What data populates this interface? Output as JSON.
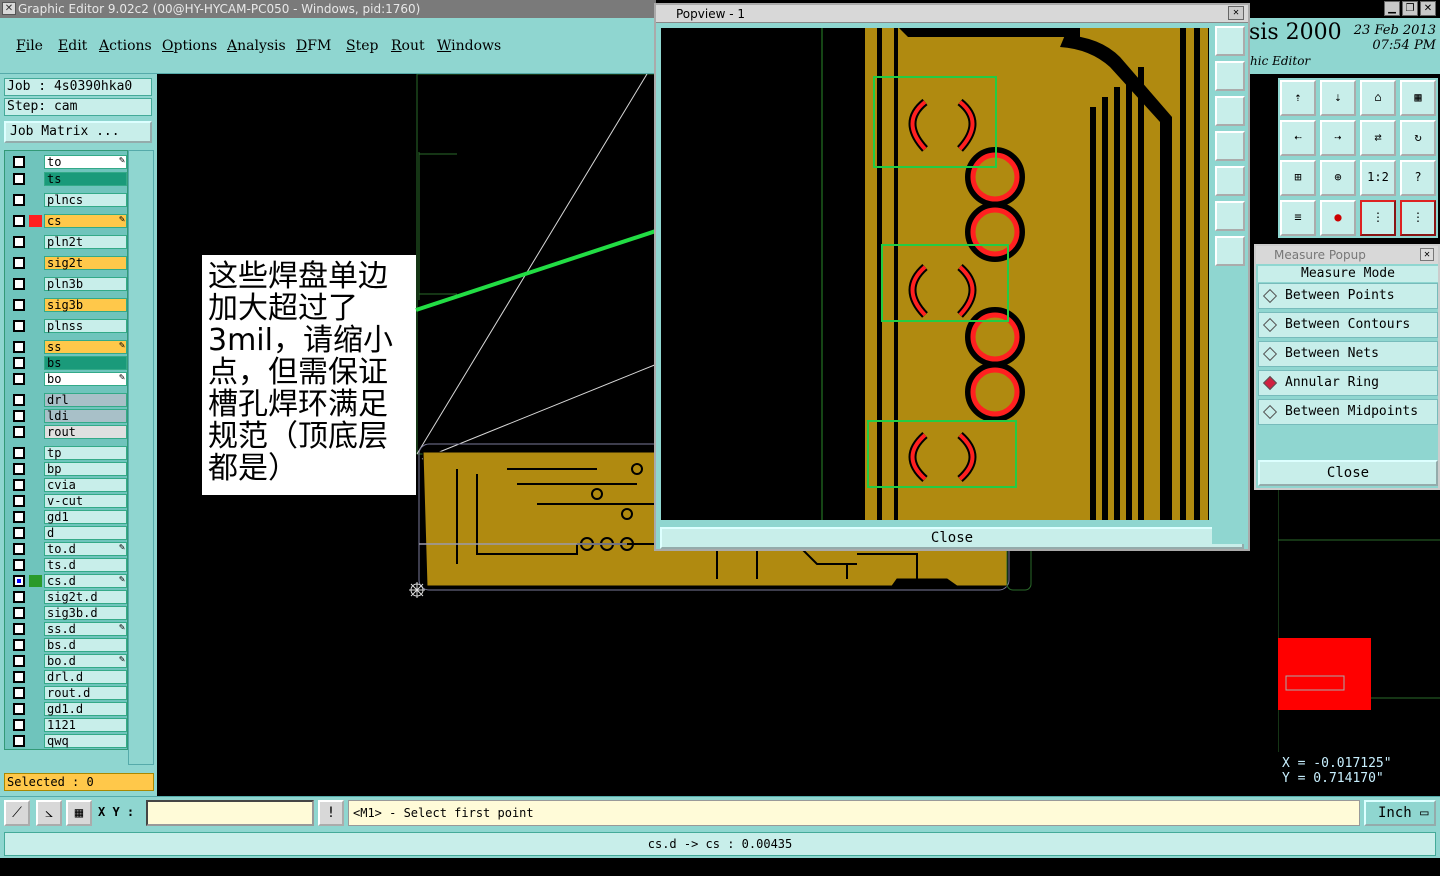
{
  "window": {
    "title": "Graphic Editor 9.02c2 (00@HY-HYCAM-PC050 - Windows, pid:1760)"
  },
  "menu": [
    "File",
    "Edit",
    "Actions",
    "Options",
    "Analysis",
    "DFM",
    "Step",
    "Rout",
    "Windows"
  ],
  "brand": {
    "name": "sis 2000",
    "sub": "hic Editor",
    "date": "23 Feb 2013",
    "time": "07:54 PM"
  },
  "job": {
    "job_label": "Job : 4s0390hka0",
    "step_label": "Step: cam",
    "matrix_label": "Job Matrix ..."
  },
  "layers": [
    {
      "name": "to",
      "color": "#ffffff",
      "pen": true
    },
    {
      "name": "ts",
      "color": "#1a9a7a",
      "pen": false
    },
    {
      "name": "plncs",
      "color": "#c8eeea",
      "pen": false
    },
    {
      "name": "cs",
      "color": "#ffc84a",
      "pen": true,
      "active": true
    },
    {
      "name": "pln2t",
      "color": "#c8eeea",
      "pen": false
    },
    {
      "name": "sig2t",
      "color": "#ffc84a",
      "pen": false
    },
    {
      "name": "pln3b",
      "color": "#c8eeea",
      "pen": false
    },
    {
      "name": "sig3b",
      "color": "#ffc84a",
      "pen": false
    },
    {
      "name": "plnss",
      "color": "#c8eeea",
      "pen": false
    },
    {
      "name": "ss",
      "color": "#ffc84a",
      "pen": true
    },
    {
      "name": "bs",
      "color": "#1a9a7a",
      "pen": false
    },
    {
      "name": "bo",
      "color": "#ffffff",
      "pen": true
    },
    {
      "name": "drl",
      "color": "#a8c0c8",
      "pen": false
    },
    {
      "name": "ldi",
      "color": "#a8c0c8",
      "pen": false
    },
    {
      "name": "rout",
      "color": "#e0e0e0",
      "pen": false
    },
    {
      "name": "tp",
      "color": "#c8eeea",
      "pen": false
    },
    {
      "name": "bp",
      "color": "#c8eeea",
      "pen": false
    },
    {
      "name": "cvia",
      "color": "#c8eeea",
      "pen": false
    },
    {
      "name": "v-cut",
      "color": "#c8eeea",
      "pen": false
    },
    {
      "name": "gd1",
      "color": "#c8eeea",
      "pen": false
    },
    {
      "name": "d",
      "color": "#c8eeea",
      "pen": false
    },
    {
      "name": "to.d",
      "color": "#c8eeea",
      "pen": true
    },
    {
      "name": "ts.d",
      "color": "#c8eeea",
      "pen": false
    },
    {
      "name": "cs.d",
      "color": "#c8eeea",
      "pen": true,
      "work": true
    },
    {
      "name": "sig2t.d",
      "color": "#c8eeea",
      "pen": false
    },
    {
      "name": "sig3b.d",
      "color": "#c8eeea",
      "pen": false
    },
    {
      "name": "ss.d",
      "color": "#c8eeea",
      "pen": true
    },
    {
      "name": "bs.d",
      "color": "#c8eeea",
      "pen": false
    },
    {
      "name": "bo.d",
      "color": "#c8eeea",
      "pen": true
    },
    {
      "name": "drl.d",
      "color": "#c8eeea",
      "pen": false
    },
    {
      "name": "rout.d",
      "color": "#c8eeea",
      "pen": false
    },
    {
      "name": "gd1.d",
      "color": "#c8eeea",
      "pen": false
    },
    {
      "name": "1121",
      "color": "#c8eeea",
      "pen": false
    },
    {
      "name": "qwq",
      "color": "#c8eeea",
      "pen": false
    }
  ],
  "selected": "Selected : 0",
  "annotation": "这些焊盘单边加大超过了3mil，请缩小点，但需保证槽孔焊环满足规范（顶底层都是）",
  "popview": {
    "title": "Popview - 1",
    "close": "Close"
  },
  "measure": {
    "title": "Measure Popup",
    "header": "Measure Mode",
    "options": [
      "Between Points",
      "Between Contours",
      "Between Nets",
      "Annular Ring",
      "Between Midpoints"
    ],
    "selected": "Annular Ring",
    "close": "Close"
  },
  "coords": {
    "x": "X = -0.017125\"",
    "y": "Y = 0.714170\""
  },
  "toolbar": {
    "xy_label": "X Y :",
    "prompt": "<M1> - Select first point",
    "units": "Inch"
  },
  "status": "cs.d -> cs : 0.00435"
}
